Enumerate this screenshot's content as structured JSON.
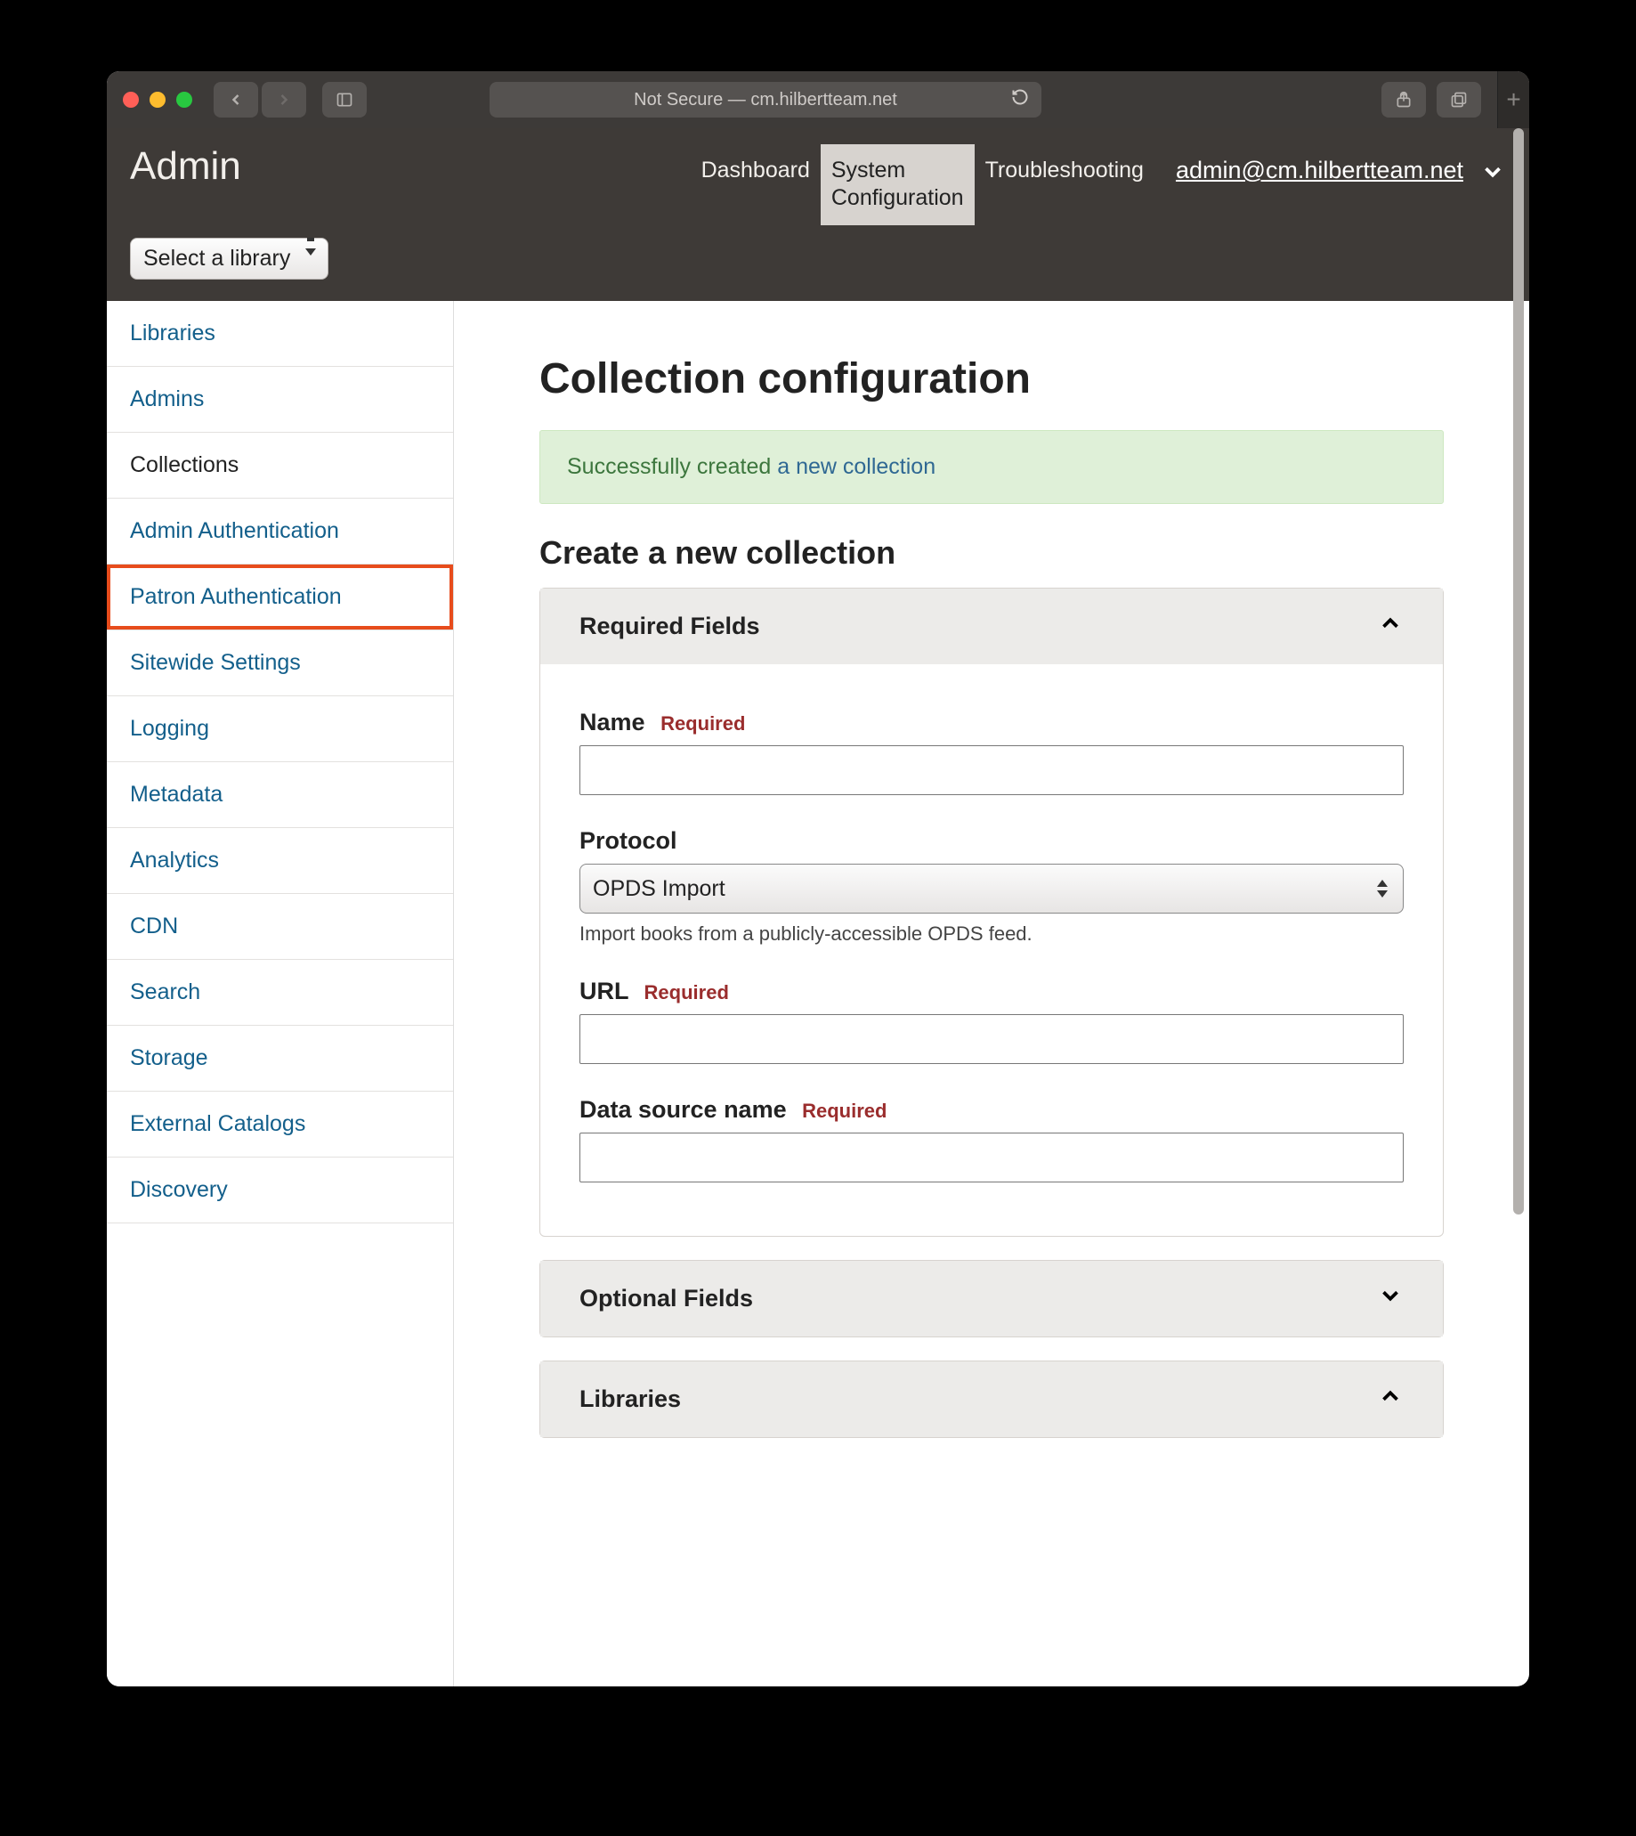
{
  "browser": {
    "address_label": "Not Secure — cm.hilbertteam.net"
  },
  "header": {
    "brand": "Admin",
    "nav": [
      {
        "label": "Dashboard",
        "active": false
      },
      {
        "line1": "System",
        "line2": "Configuration",
        "active": true
      },
      {
        "label": "Troubleshooting",
        "active": false
      }
    ],
    "user_email": "admin@cm.hilbertteam.net",
    "library_selector": "Select a library"
  },
  "sidebar": {
    "items": [
      {
        "label": "Libraries"
      },
      {
        "label": "Admins"
      },
      {
        "label": "Collections",
        "current": true
      },
      {
        "label": "Admin Authentication"
      },
      {
        "label": "Patron Authentication",
        "highlight": true
      },
      {
        "label": "Sitewide Settings"
      },
      {
        "label": "Logging"
      },
      {
        "label": "Metadata"
      },
      {
        "label": "Analytics"
      },
      {
        "label": "CDN"
      },
      {
        "label": "Search"
      },
      {
        "label": "Storage"
      },
      {
        "label": "External Catalogs"
      },
      {
        "label": "Discovery"
      }
    ]
  },
  "main": {
    "title": "Collection configuration",
    "alert_text": "Successfully created ",
    "alert_link": "a new collection",
    "section_title": "Create a new collection",
    "panels": {
      "required": {
        "title": "Required Fields",
        "expanded": true,
        "fields": {
          "name": {
            "label": "Name",
            "required_tag": "Required",
            "value": ""
          },
          "protocol": {
            "label": "Protocol",
            "selected": "OPDS Import",
            "help": "Import books from a publicly-accessible OPDS feed."
          },
          "url": {
            "label": "URL",
            "required_tag": "Required",
            "value": ""
          },
          "data_source": {
            "label": "Data source name",
            "required_tag": "Required",
            "value": ""
          }
        }
      },
      "optional": {
        "title": "Optional Fields",
        "expanded": false
      },
      "libraries": {
        "title": "Libraries",
        "expanded": true
      }
    }
  }
}
